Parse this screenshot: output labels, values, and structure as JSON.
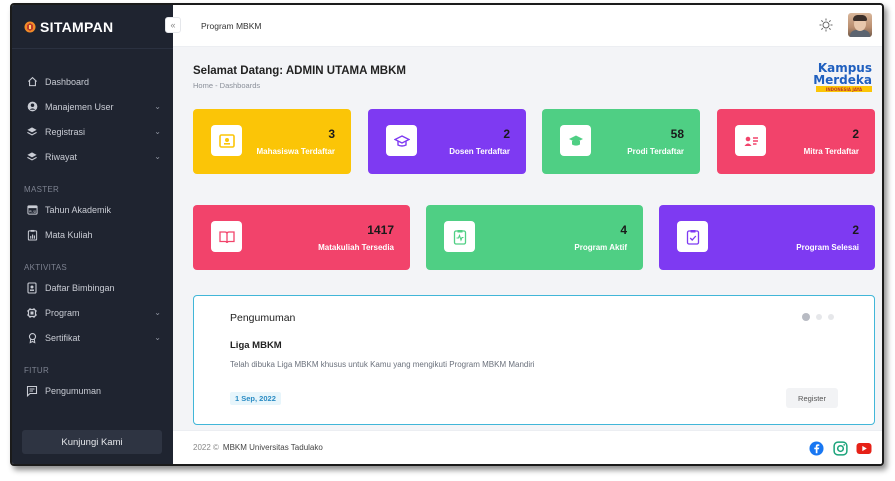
{
  "app": {
    "brand": "SITAMPAN"
  },
  "topbar": {
    "title": "Program MBKM"
  },
  "sidebar": {
    "items": [
      {
        "label": "Dashboard"
      },
      {
        "label": "Manajemen User"
      },
      {
        "label": "Registrasi"
      },
      {
        "label": "Riwayat"
      }
    ],
    "section_master": "MASTER",
    "master_items": [
      {
        "label": "Tahun Akademik"
      },
      {
        "label": "Mata Kuliah"
      }
    ],
    "section_aktivitas": "AKTIVITAS",
    "aktivitas_items": [
      {
        "label": "Daftar Bimbingan"
      },
      {
        "label": "Program"
      },
      {
        "label": "Sertifikat"
      }
    ],
    "section_fitur": "FITUR",
    "fitur_items": [
      {
        "label": "Pengumuman"
      }
    ],
    "visit_button": "Kunjungi Kami",
    "collapse_icon": "«"
  },
  "main": {
    "welcome": "Selamat Datang: ADMIN UTAMA MBKM",
    "breadcrumb": "Home  -  Dashboards",
    "logo": {
      "line1": "Kampus",
      "line2": "Merdeka",
      "tagline": "INDONESIA JAYA"
    },
    "cards_row1": [
      {
        "value": "3",
        "label": "Mahasiswa Terdaftar",
        "color": "#fbc507"
      },
      {
        "value": "2",
        "label": "Dosen Terdaftar",
        "color": "#7e3af2"
      },
      {
        "value": "58",
        "label": "Prodi Terdaftar",
        "color": "#4fcf84"
      },
      {
        "value": "2",
        "label": "Mitra Terdaftar",
        "color": "#f2436b"
      }
    ],
    "cards_row2": [
      {
        "value": "1417",
        "label": "Matakuliah Tersedia",
        "color": "#f2436b"
      },
      {
        "value": "4",
        "label": "Program Aktif",
        "color": "#4fcf84"
      },
      {
        "value": "2",
        "label": "Program Selesai",
        "color": "#7e3af2"
      }
    ],
    "announcement": {
      "title": "Pengumuman",
      "heading": "Liga MBKM",
      "body": "Telah dibuka Liga MBKM khusus untuk Kamu yang mengikuti Program MBKM Mandiri",
      "date": "1 Sep, 2022",
      "button": "Register"
    }
  },
  "footer": {
    "year": "2022 ©",
    "org": "MBKM Universitas Tadulako"
  }
}
